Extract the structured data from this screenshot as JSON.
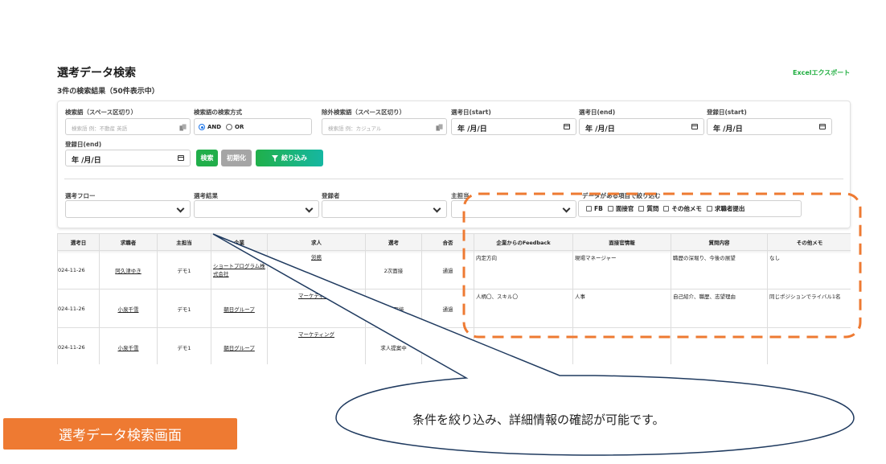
{
  "page": {
    "title": "選考データ検索",
    "result_count": "3件の検索結果（50件表示中）",
    "excel_export": "Excelエクスポート"
  },
  "search": {
    "keyword_label": "検索語（スペース区切り）",
    "keyword_placeholder": "検索語 例：不動産 英語",
    "method_label": "検索語の検索方式",
    "method_options": [
      "AND",
      "OR"
    ],
    "method_selected": "AND",
    "exclude_label": "除外検索語（スペース区切り）",
    "exclude_placeholder": "検索語 例：カジュアル",
    "selection_start_label": "選考日(start)",
    "selection_end_label": "選考日(end)",
    "registered_start_label": "登録日(start)",
    "registered_end_label": "登録日(end)",
    "date_value": "年 /月/日",
    "search_button": "検索",
    "reset_button": "初期化",
    "filter_button": "絞り込み"
  },
  "filters": {
    "flow_label": "選考フロー",
    "result_label": "選考結果",
    "registrant_label": "登録者",
    "owner_label": "主担当",
    "data_filter_label": "データがある項目で絞り込む",
    "checkboxes": [
      "FB",
      "面接官",
      "質問",
      "その他メモ",
      "求職者提出"
    ]
  },
  "table": {
    "columns": [
      "選考日",
      "求職者",
      "主担当",
      "企業",
      "求人",
      "選考",
      "合否",
      "企業からのFeedback",
      "面接官情報",
      "質問内容",
      "その他メモ"
    ],
    "rows": [
      {
        "date": "024-11-26",
        "candidate": "阿久津ゆき",
        "owner": "デモ1",
        "company": "ショートプログラム株式会社",
        "job": "労務",
        "stage": "2次面接",
        "result": "通過",
        "feedback": "内定方向",
        "interviewer": "現場マネージャー",
        "questions": "職歴の深堀り、今後の展望",
        "memo": "なし"
      },
      {
        "date": "024-11-26",
        "candidate": "小泉千雪",
        "owner": "デモ1",
        "company": "朝日グループ",
        "job": "マーケティング",
        "stage": "一次面接",
        "result": "通過",
        "feedback": "人柄〇、スキル〇",
        "interviewer": "人事",
        "questions": "自己紹介、職歴、志望理由",
        "memo": "同じポジションでライバル1名"
      },
      {
        "date": "024-11-26",
        "candidate": "小泉千雪",
        "owner": "デモ1",
        "company": "朝日グループ",
        "job": "マーケティング",
        "stage": "求人提案中",
        "result": "",
        "feedback": "",
        "interviewer": "",
        "questions": "",
        "memo": ""
      }
    ]
  },
  "annotation": {
    "callout": "条件を絞り込み、詳細情報の確認が可能です。",
    "label": "選考データ検索画面"
  },
  "colors": {
    "accent_green": "#21ae4a",
    "annotation_orange": "#ee7a32",
    "callout_line": "#1f3a5f"
  }
}
